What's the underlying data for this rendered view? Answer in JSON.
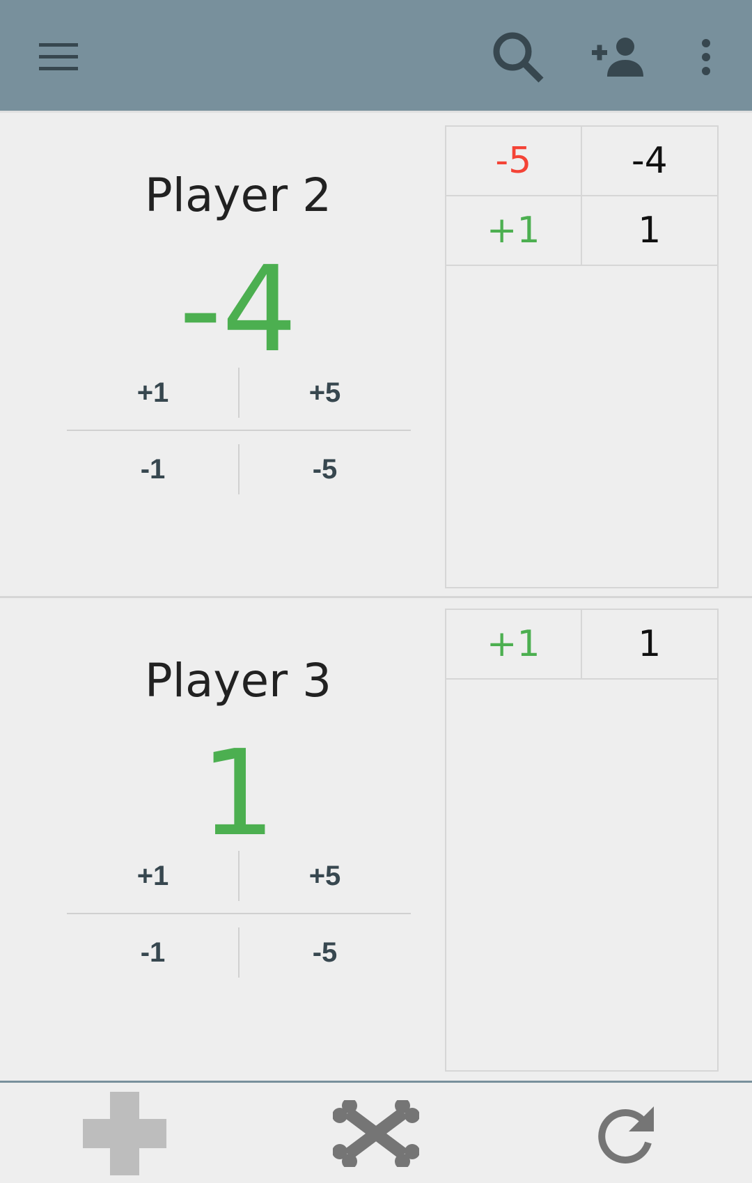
{
  "toolbar": {
    "background": "#78909c",
    "icons": [
      "menu-icon",
      "search-icon",
      "add-person-icon",
      "more-vertical-icon"
    ]
  },
  "players": [
    {
      "name": "Player 2",
      "score": "-4",
      "score_color": "#4caf50",
      "buttons": {
        "plus1": "+1",
        "plus5": "+5",
        "minus1": "-1",
        "minus5": "-5"
      },
      "history": [
        {
          "delta": "-5",
          "delta_color": "#f44336",
          "total": "-4"
        },
        {
          "delta": "+1",
          "delta_color": "#4caf50",
          "total": "1"
        }
      ]
    },
    {
      "name": "Player 3",
      "score": "1",
      "score_color": "#4caf50",
      "buttons": {
        "plus1": "+1",
        "plus5": "+5",
        "minus1": "-1",
        "minus5": "-5"
      },
      "history": [
        {
          "delta": "+1",
          "delta_color": "#4caf50",
          "total": "1"
        }
      ]
    }
  ],
  "bottombar": {
    "icons": [
      "add-icon",
      "crossbones-icon",
      "refresh-icon"
    ],
    "add_color": "#bdbdbd",
    "icon_color": "#757575"
  }
}
